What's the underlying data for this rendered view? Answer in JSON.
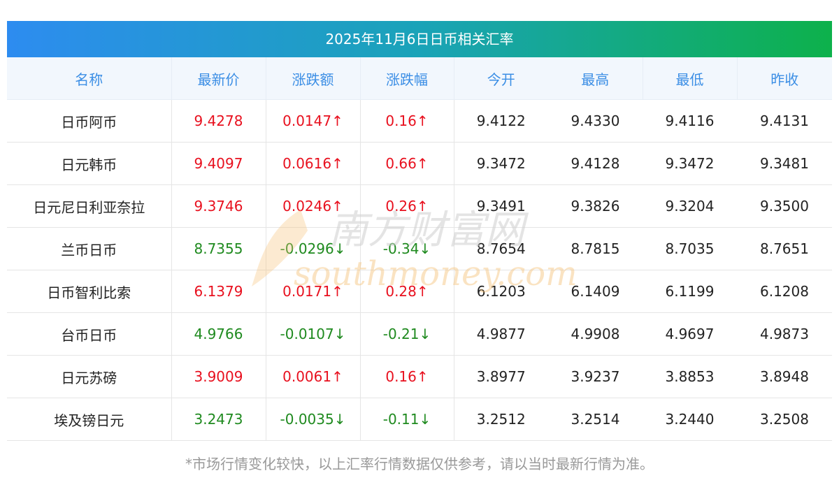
{
  "title": "2025年11月6日日币相关汇率",
  "columns": [
    "名称",
    "最新价",
    "涨跌额",
    "涨跌幅",
    "今开",
    "最高",
    "最低",
    "昨收"
  ],
  "rows": [
    {
      "name": "日币阿币",
      "latest": "9.4278",
      "change": "0.0147↑",
      "pct": "0.16↑",
      "dir": "up",
      "open": "9.4122",
      "high": "9.4330",
      "low": "9.4116",
      "prev": "9.4131"
    },
    {
      "name": "日元韩币",
      "latest": "9.4097",
      "change": "0.0616↑",
      "pct": "0.66↑",
      "dir": "up",
      "open": "9.3472",
      "high": "9.4128",
      "low": "9.3472",
      "prev": "9.3481"
    },
    {
      "name": "日元尼日利亚奈拉",
      "latest": "9.3746",
      "change": "0.0246↑",
      "pct": "0.26↑",
      "dir": "up",
      "open": "9.3491",
      "high": "9.3826",
      "low": "9.3204",
      "prev": "9.3500"
    },
    {
      "name": "兰币日币",
      "latest": "8.7355",
      "change": "-0.0296↓",
      "pct": "-0.34↓",
      "dir": "down",
      "open": "8.7654",
      "high": "8.7815",
      "low": "8.7035",
      "prev": "8.7651"
    },
    {
      "name": "日币智利比索",
      "latest": "6.1379",
      "change": "0.0171↑",
      "pct": "0.28↑",
      "dir": "up",
      "open": "6.1203",
      "high": "6.1409",
      "low": "6.1199",
      "prev": "6.1208"
    },
    {
      "name": "台币日币",
      "latest": "4.9766",
      "change": "-0.0107↓",
      "pct": "-0.21↓",
      "dir": "down",
      "open": "4.9877",
      "high": "4.9908",
      "low": "4.9697",
      "prev": "4.9873"
    },
    {
      "name": "日元苏磅",
      "latest": "3.9009",
      "change": "0.0061↑",
      "pct": "0.16↑",
      "dir": "up",
      "open": "3.8977",
      "high": "3.9237",
      "low": "3.8853",
      "prev": "3.8948"
    },
    {
      "name": "埃及镑日元",
      "latest": "3.2473",
      "change": "-0.0035↓",
      "pct": "-0.11↓",
      "dir": "down",
      "open": "3.2512",
      "high": "3.2514",
      "low": "3.2440",
      "prev": "3.2508"
    }
  ],
  "footnote": "*市场行情变化较快，以上汇率行情数据仅供参考，请以当时最新行情为准。",
  "watermark": {
    "cn": "南方财富网",
    "en": "southmoney.com"
  },
  "colors": {
    "up": "#e8101e",
    "down": "#1f8a1f",
    "header_text": "#3b8ee5",
    "gradient_start": "#2d8cf0",
    "gradient_end": "#0db14b"
  }
}
